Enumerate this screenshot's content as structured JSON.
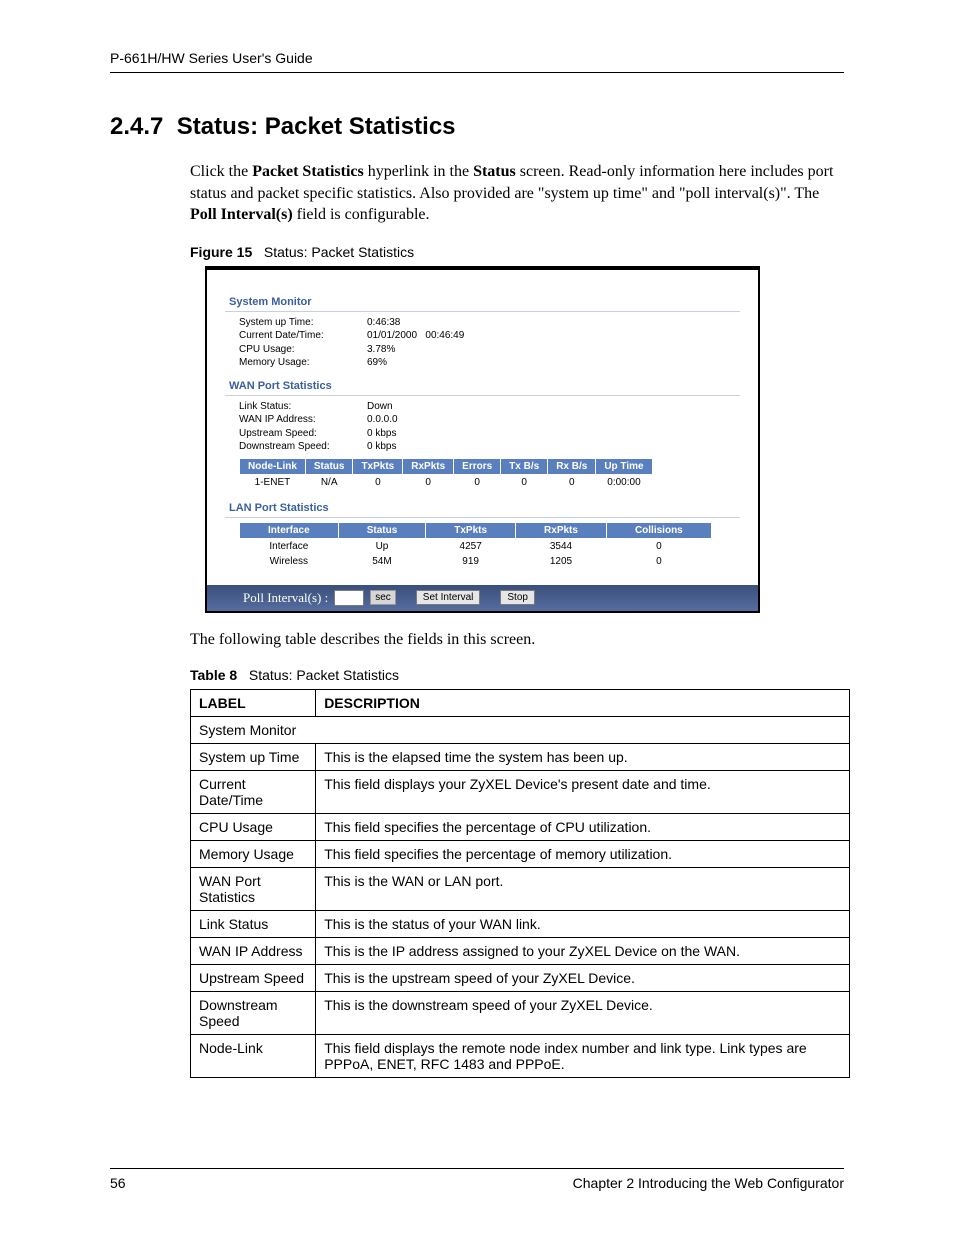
{
  "running_head": "P-661H/HW Series User's Guide",
  "section_number": "2.4.7",
  "section_title": "Status: Packet Statistics",
  "intro_html": "Click the <b>Packet Statistics</b> hyperlink in the <b>Status</b> screen. Read-only information here includes port status and packet specific statistics. Also provided are \"system up time\" and \"poll interval(s)\". The <b>Poll Interval(s)</b> field is configurable.",
  "figure_label": "Figure 15",
  "figure_title": "Status: Packet Statistics",
  "screenshot": {
    "panels": {
      "system_monitor": {
        "title": "System Monitor",
        "rows": [
          {
            "label": "System up Time:",
            "value": "0:46:38"
          },
          {
            "label": "Current Date/Time:",
            "value": "01/01/2000   00:46:49"
          },
          {
            "label": "CPU Usage:",
            "value": "3.78%"
          },
          {
            "label": "Memory Usage:",
            "value": "69%"
          }
        ]
      },
      "wan": {
        "title": "WAN Port Statistics",
        "rows": [
          {
            "label": "Link Status:",
            "value": "Down"
          },
          {
            "label": "WAN IP Address:",
            "value": "0.0.0.0"
          },
          {
            "label": "Upstream Speed:",
            "value": "0 kbps"
          },
          {
            "label": "Downstream Speed:",
            "value": "0 kbps"
          }
        ],
        "headers": [
          "Node-Link",
          "Status",
          "TxPkts",
          "RxPkts",
          "Errors",
          "Tx B/s",
          "Rx B/s",
          "Up Time"
        ],
        "data": [
          [
            "1-ENET",
            "N/A",
            "0",
            "0",
            "0",
            "0",
            "0",
            "0:00:00"
          ]
        ]
      },
      "lan": {
        "title": "LAN Port Statistics",
        "headers": [
          "Interface",
          "Status",
          "TxPkts",
          "RxPkts",
          "Collisions"
        ],
        "data": [
          [
            "Interface",
            "Up",
            "4257",
            "3544",
            "0"
          ],
          [
            "Wireless",
            "54M",
            "919",
            "1205",
            "0"
          ]
        ]
      }
    },
    "poll": {
      "label": "Poll Interval(s) :",
      "unit": "sec",
      "set_btn": "Set Interval",
      "stop_btn": "Stop"
    }
  },
  "follow_text": "The following table describes the fields in this screen.",
  "table_label": "Table 8",
  "table_title": "Status: Packet Statistics",
  "desc_headers": {
    "label": "LABEL",
    "desc": "DESCRIPTION"
  },
  "desc_rows": [
    {
      "span": true,
      "label": "System Monitor"
    },
    {
      "label": "System up Time",
      "desc": "This is the elapsed time the system has been up."
    },
    {
      "label": "Current Date/Time",
      "desc": "This field displays your ZyXEL Device's present date and time."
    },
    {
      "label": "CPU Usage",
      "desc": "This field specifies the percentage of CPU utilization."
    },
    {
      "label": "Memory Usage",
      "desc": "This field specifies the percentage of memory utilization."
    },
    {
      "label": "WAN Port Statistics",
      "desc": "This is the WAN or LAN port."
    },
    {
      "label": "Link Status",
      "desc": "This is the status of your WAN link."
    },
    {
      "label": "WAN IP Address",
      "desc": "This is the IP address assigned to your ZyXEL Device on the WAN."
    },
    {
      "label": "Upstream Speed",
      "desc": "This is the upstream speed of your ZyXEL Device."
    },
    {
      "label": "Downstream Speed",
      "desc": "This is the downstream speed of your ZyXEL Device."
    },
    {
      "label": "Node-Link",
      "desc": "This field displays the remote node index number and link type. Link types are PPPoA, ENET, RFC 1483 and PPPoE."
    }
  ],
  "footer": {
    "page": "56",
    "chapter": "Chapter 2 Introducing the Web Configurator"
  }
}
